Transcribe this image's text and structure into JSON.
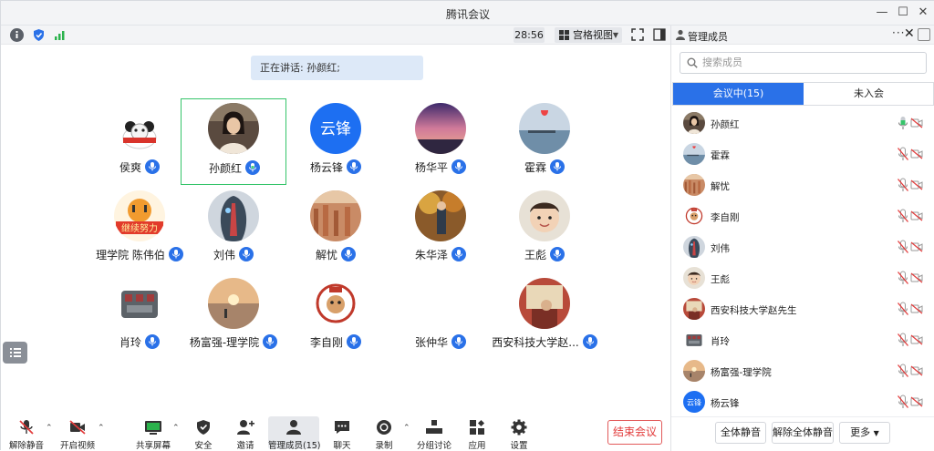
{
  "window": {
    "title": "腾讯会议"
  },
  "infobar": {
    "timer": "28:56",
    "view_label": "宫格视图"
  },
  "speaking": {
    "text": "正在讲话: 孙颜红;"
  },
  "colors": {
    "accent": "#2a71e8",
    "active_border": "#35c46a",
    "end": "#e23b3b"
  },
  "tiles": [
    {
      "name": "侯爽",
      "avatar": "panda-avatar",
      "active": false
    },
    {
      "name": "孙颜红",
      "avatar": "photo-avatar",
      "active": true
    },
    {
      "name": "杨云锋",
      "avatar": "text-avatar",
      "avatar_text": "云锋",
      "active": false
    },
    {
      "name": "杨华平",
      "avatar": "sunset-avatar",
      "active": false
    },
    {
      "name": "霍霖",
      "avatar": "sea-avatar",
      "active": false
    },
    {
      "name": "理学院 陈伟伯",
      "avatar": "tiger-avatar",
      "active": false
    },
    {
      "name": "刘伟",
      "avatar": "robot-avatar",
      "active": false
    },
    {
      "name": "解忧",
      "avatar": "canyon-avatar",
      "active": false
    },
    {
      "name": "朱华泽",
      "avatar": "autumn-avatar",
      "active": false
    },
    {
      "name": "王彪",
      "avatar": "baby-avatar",
      "active": false
    },
    {
      "name": "肖玲",
      "avatar": "engine-avatar",
      "active": false
    },
    {
      "name": "杨富强-理学院",
      "avatar": "beach-avatar",
      "active": false
    },
    {
      "name": "李自刚",
      "avatar": "seal-avatar",
      "active": false
    },
    {
      "name": "张仲华",
      "avatar": "blank-avatar",
      "active": false
    },
    {
      "name": "西安科技大学赵...",
      "avatar": "room-avatar",
      "active": false
    }
  ],
  "tiles_big_text_avatar": "云锋",
  "toolbar": {
    "unmute": "解除静音",
    "start_video": "开启视频",
    "share": "共享屏幕",
    "security": "安全",
    "invite": "邀请",
    "members": "管理成员(15)",
    "chat": "聊天",
    "record": "录制",
    "breakout": "分组讨论",
    "apps": "应用",
    "settings": "设置",
    "end_meeting": "结束会议"
  },
  "panel": {
    "title": "管理成员",
    "search_placeholder": "搜索成员",
    "tab_in_meeting": "会议中(15)",
    "tab_not_joined": "未入会",
    "members": [
      {
        "name": "孙颜红",
        "avatar": "photo-avatar",
        "mic": "on"
      },
      {
        "name": "霍霖",
        "avatar": "sea-avatar",
        "mic": "muted"
      },
      {
        "name": "解忧",
        "avatar": "canyon-avatar",
        "mic": "muted"
      },
      {
        "name": "李自刚",
        "avatar": "seal-avatar",
        "mic": "muted"
      },
      {
        "name": "刘伟",
        "avatar": "robot-avatar",
        "mic": "muted"
      },
      {
        "name": "王彪",
        "avatar": "baby-avatar",
        "mic": "muted"
      },
      {
        "name": "西安科技大学赵先生",
        "avatar": "room-avatar",
        "mic": "muted"
      },
      {
        "name": "肖玲",
        "avatar": "engine-avatar",
        "mic": "muted"
      },
      {
        "name": "杨富强-理学院",
        "avatar": "beach-avatar",
        "mic": "muted"
      },
      {
        "name": "杨云锋",
        "avatar": "text-avatar",
        "avatar_text": "云锋",
        "mic": "muted"
      }
    ],
    "mute_all": "全体静音",
    "unmute_all": "解除全体静音",
    "more": "更多"
  }
}
